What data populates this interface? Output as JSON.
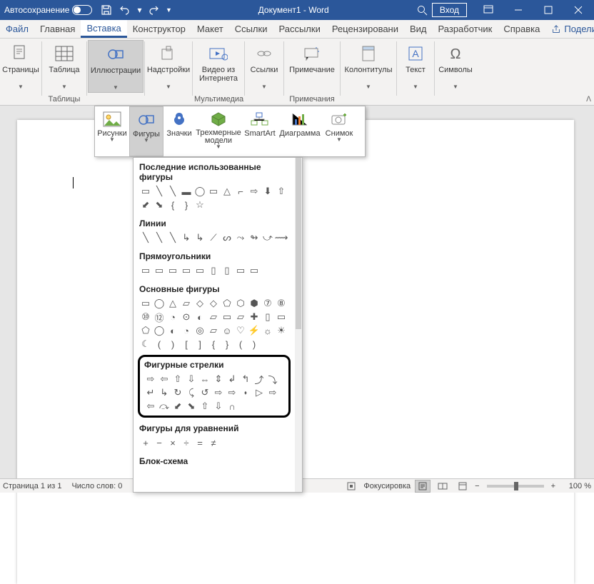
{
  "titlebar": {
    "autosave_label": "Автосохранение",
    "doc_title": "Документ1 - Word",
    "login_label": "Вход"
  },
  "tabs": {
    "file": "Файл",
    "home": "Главная",
    "insert": "Вставка",
    "design": "Конструктор",
    "layout": "Макет",
    "references": "Ссылки",
    "mailings": "Рассылки",
    "review": "Рецензировани",
    "view": "Вид",
    "developer": "Разработчик",
    "help": "Справка",
    "share": "Поделиться"
  },
  "ribbon": {
    "pages": "Страницы",
    "table": "Таблица",
    "tables_group": "Таблицы",
    "illustrations": "Иллюстрации",
    "addins": "Надстройки",
    "online_video": "Видео из Интернета",
    "multimedia_group": "Мультимедиа",
    "links": "Ссылки",
    "comment": "Примечание",
    "comment_group": "Примечания",
    "header_footer": "Колонтитулы",
    "text": "Текст",
    "symbols": "Символы"
  },
  "flyout": {
    "pictures": "Рисунки",
    "shapes": "Фигуры",
    "icons": "Значки",
    "threed": "Трехмерные модели",
    "smartart": "SmartArt",
    "chart": "Диаграмма",
    "screenshot": "Снимок"
  },
  "shapes_panel": {
    "recent": "Последние использованные фигуры",
    "lines": "Линии",
    "rects": "Прямоугольники",
    "basic": "Основные фигуры",
    "arrows": "Фигурные стрелки",
    "equation": "Фигуры для уравнений",
    "flowchart": "Блок-схема"
  },
  "statusbar": {
    "page": "Страница 1 из 1",
    "words": "Число слов: 0",
    "focus": "Фокусировка",
    "zoom_label": "100 %"
  },
  "glyphs": {
    "recent_row1": [
      "▭",
      "╲",
      "╲",
      "▬",
      "◯",
      "▭",
      "△",
      "⌐",
      "⇨",
      "⬇",
      "⇧"
    ],
    "recent_row2": [
      "⬋",
      "⬊",
      "{",
      "}",
      "☆"
    ],
    "lines_row": [
      "╲",
      "╲",
      "╲",
      "↳",
      "↳",
      "⟋",
      "ᔕ",
      "⤳",
      "↬",
      "⤻",
      "⟿"
    ],
    "rects_row": [
      "▭",
      "▭",
      "▭",
      "▭",
      "▭",
      "▯",
      "▯",
      "▭",
      "▭"
    ],
    "basic_r1": [
      "▭",
      "◯",
      "△",
      "▱",
      "◇",
      "◇",
      "⬠",
      "⬡",
      "⬢",
      "⑦",
      "⑧",
      "⑩"
    ],
    "basic_r2": [
      "⑫",
      "◔",
      "⊙",
      "◐",
      "▱",
      "▭",
      "▱",
      "✚",
      "▯",
      "▭",
      "⬠",
      "◯"
    ],
    "basic_r3": [
      "◐",
      "◔",
      "◎",
      "▱",
      "☺",
      "♡",
      "⚡",
      "☼",
      "☀",
      "☾",
      "(",
      ")"
    ],
    "basic_r4": [
      "[",
      "]",
      "{",
      "}",
      "(",
      ")"
    ],
    "arrows_r1": [
      "⇨",
      "⇦",
      "⇧",
      "⇩",
      "⇔",
      "⇕",
      "↲",
      "↰",
      "⤴",
      "⤵",
      "↵",
      "↳"
    ],
    "arrows_r2": [
      "↻",
      "⤹",
      "↺",
      "⇨",
      "⇨",
      "⬪",
      "▷",
      "⇨",
      "⇦",
      "⤼",
      "⬋",
      "⬊"
    ],
    "arrows_r3": [
      "⇧",
      "⇩",
      "∩"
    ],
    "equation_row": [
      "+",
      "−",
      "×",
      "÷",
      "=",
      "≠"
    ]
  }
}
